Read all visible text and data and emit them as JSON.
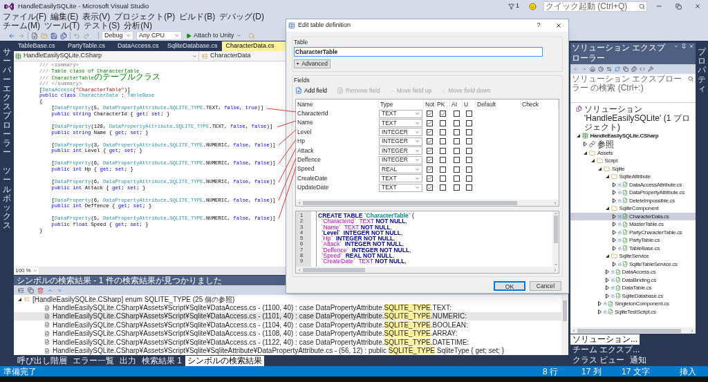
{
  "window": {
    "title": "HandleEasilySQLite - Microsoft Visual Studio"
  },
  "title_bar": {
    "notifications": "1",
    "quick_launch": {
      "placeholder": "クイック起動 (Ctrl+Q)"
    }
  },
  "menu": [
    "ファイル(F)",
    "編集(E)",
    "表示(V)",
    "プロジェクト(P)",
    "ビルド(B)",
    "デバッグ(D)",
    "チーム(M)",
    "ツール(T)",
    "テスト(S)",
    "分析(N)"
  ],
  "toolbar": {
    "configuration": "Debug",
    "platform": "Any CPU",
    "run_button": "Attach to Unity"
  },
  "left_strip": [
    "サーバーエクスプローラー",
    "ツールボックス"
  ],
  "editor": {
    "tabs": [
      {
        "label": "TableBase.cs",
        "selected": false
      },
      {
        "label": "PartyTable.cs",
        "selected": false
      },
      {
        "label": "DataAccess.cs",
        "selected": false
      },
      {
        "label": "SqliteDatabase.cs",
        "selected": false
      },
      {
        "label": "CharacterData.cs",
        "selected": true
      }
    ],
    "project": "HandleEasilySQLite.CSharp",
    "member": "CharacterData",
    "zoom": "100 %",
    "lines": [
      {
        "tokens": [
          {
            "kind": "doc",
            "text": "/// <summary>"
          }
        ]
      },
      {
        "tokens": [
          {
            "kind": "doc",
            "text": "/// "
          },
          {
            "kind": "cm",
            "text": "Table class of CharacterTable"
          }
        ]
      },
      {
        "tokens": [
          {
            "kind": "doc",
            "text": "/// "
          },
          {
            "kind": "cm",
            "text": "CharacterTable"
          },
          {
            "kind": "cmj",
            "text": "のテーブルクラス"
          }
        ]
      },
      {
        "tokens": [
          {
            "kind": "doc",
            "text": "/// </summary>"
          }
        ]
      },
      {
        "tokens": [
          {
            "kind": "p",
            "text": "["
          },
          {
            "kind": "ty",
            "text": "DataAccess"
          },
          {
            "kind": "p",
            "text": "("
          },
          {
            "kind": "str",
            "text": "\"CharacterTable\""
          },
          {
            "kind": "p",
            "text": ")]"
          }
        ]
      },
      {
        "tokens": [
          {
            "kind": "kw",
            "text": "public class "
          },
          {
            "kind": "ty",
            "text": "CharacterData"
          },
          {
            "kind": "p",
            "text": " : "
          },
          {
            "kind": "ty",
            "text": "TableBase"
          }
        ]
      },
      {
        "tokens": [
          {
            "kind": "p",
            "text": "{"
          }
        ]
      },
      {
        "tokens": [
          {
            "kind": "p",
            "text": "    ["
          },
          {
            "kind": "ty",
            "text": "DataProperty"
          },
          {
            "kind": "p",
            "text": "(5, "
          },
          {
            "kind": "ty",
            "text": "DataPropertyAttribute"
          },
          {
            "kind": "p",
            "text": "."
          },
          {
            "kind": "ty",
            "text": "SQLITE_TYPE"
          },
          {
            "kind": "p",
            "text": ".TEXT, "
          },
          {
            "kind": "kw",
            "text": "false"
          },
          {
            "kind": "p",
            "text": ", "
          },
          {
            "kind": "kw",
            "text": "true"
          },
          {
            "kind": "p",
            "text": ")]"
          }
        ]
      },
      {
        "tokens": [
          {
            "kind": "kw",
            "text": "    public string "
          },
          {
            "kind": "p",
            "text": "CharacterId { "
          },
          {
            "kind": "kw",
            "text": "get"
          },
          {
            "kind": "p",
            "text": "; "
          },
          {
            "kind": "kw",
            "text": "set"
          },
          {
            "kind": "p",
            "text": "; }"
          }
        ]
      },
      {
        "blank": true
      },
      {
        "tokens": [
          {
            "kind": "p",
            "text": "    ["
          },
          {
            "kind": "ty",
            "text": "DataProperty"
          },
          {
            "kind": "p",
            "text": "(128, "
          },
          {
            "kind": "ty",
            "text": "DataPropertyAttribute"
          },
          {
            "kind": "p",
            "text": "."
          },
          {
            "kind": "ty",
            "text": "SQLITE_TYPE"
          },
          {
            "kind": "p",
            "text": ".TEXT, "
          },
          {
            "kind": "kw",
            "text": "false"
          },
          {
            "kind": "p",
            "text": ", "
          },
          {
            "kind": "kw",
            "text": "false"
          },
          {
            "kind": "p",
            "text": ")]"
          }
        ]
      },
      {
        "tokens": [
          {
            "kind": "kw",
            "text": "    public string "
          },
          {
            "kind": "p",
            "text": "Name { "
          },
          {
            "kind": "kw",
            "text": "get"
          },
          {
            "kind": "p",
            "text": "; "
          },
          {
            "kind": "kw",
            "text": "set"
          },
          {
            "kind": "p",
            "text": "; }"
          }
        ]
      },
      {
        "blank": true
      },
      {
        "tokens": [
          {
            "kind": "p",
            "text": "    ["
          },
          {
            "kind": "ty",
            "text": "DataProperty"
          },
          {
            "kind": "p",
            "text": "(3, "
          },
          {
            "kind": "ty",
            "text": "DataPropertyAttribute"
          },
          {
            "kind": "p",
            "text": "."
          },
          {
            "kind": "ty",
            "text": "SQLITE_TYPE"
          },
          {
            "kind": "p",
            "text": ".NUMERIC, "
          },
          {
            "kind": "kw",
            "text": "false"
          },
          {
            "kind": "p",
            "text": ", "
          },
          {
            "kind": "kw",
            "text": "false"
          },
          {
            "kind": "p",
            "text": ")]"
          }
        ]
      },
      {
        "tokens": [
          {
            "kind": "kw",
            "text": "    public int "
          },
          {
            "kind": "p",
            "text": "Level { "
          },
          {
            "kind": "kw",
            "text": "get"
          },
          {
            "kind": "p",
            "text": "; "
          },
          {
            "kind": "kw",
            "text": "set"
          },
          {
            "kind": "p",
            "text": "; }"
          }
        ]
      },
      {
        "blank": true
      },
      {
        "tokens": [
          {
            "kind": "p",
            "text": "    ["
          },
          {
            "kind": "ty",
            "text": "DataProperty"
          },
          {
            "kind": "p",
            "text": "(6, "
          },
          {
            "kind": "ty",
            "text": "DataPropertyAttribute"
          },
          {
            "kind": "p",
            "text": "."
          },
          {
            "kind": "ty",
            "text": "SQLITE_TYPE"
          },
          {
            "kind": "p",
            "text": ".NUMERIC, "
          },
          {
            "kind": "kw",
            "text": "false"
          },
          {
            "kind": "p",
            "text": ", "
          },
          {
            "kind": "kw",
            "text": "false"
          },
          {
            "kind": "p",
            "text": ")]"
          }
        ]
      },
      {
        "tokens": [
          {
            "kind": "kw",
            "text": "    public int "
          },
          {
            "kind": "p",
            "text": "Hp { "
          },
          {
            "kind": "kw",
            "text": "get"
          },
          {
            "kind": "p",
            "text": "; "
          },
          {
            "kind": "kw",
            "text": "set"
          },
          {
            "kind": "p",
            "text": "; }"
          }
        ]
      },
      {
        "blank": true
      },
      {
        "tokens": [
          {
            "kind": "p",
            "text": "    ["
          },
          {
            "kind": "ty",
            "text": "DataProperty"
          },
          {
            "kind": "p",
            "text": "(6, "
          },
          {
            "kind": "ty",
            "text": "DataPropertyAttribute"
          },
          {
            "kind": "p",
            "text": "."
          },
          {
            "kind": "ty",
            "text": "SQLITE_TYPE"
          },
          {
            "kind": "p",
            "text": ".NUMERIC, "
          },
          {
            "kind": "kw",
            "text": "false"
          },
          {
            "kind": "p",
            "text": ", "
          },
          {
            "kind": "kw",
            "text": "false"
          },
          {
            "kind": "p",
            "text": ")]"
          }
        ]
      },
      {
        "tokens": [
          {
            "kind": "kw",
            "text": "    public int "
          },
          {
            "kind": "p",
            "text": "Attack { "
          },
          {
            "kind": "kw",
            "text": "get"
          },
          {
            "kind": "p",
            "text": "; "
          },
          {
            "kind": "kw",
            "text": "set"
          },
          {
            "kind": "p",
            "text": "; }"
          }
        ]
      },
      {
        "blank": true
      },
      {
        "tokens": [
          {
            "kind": "p",
            "text": "    ["
          },
          {
            "kind": "ty",
            "text": "DataProperty"
          },
          {
            "kind": "p",
            "text": "(6, "
          },
          {
            "kind": "ty",
            "text": "DataPropertyAttribute"
          },
          {
            "kind": "p",
            "text": "."
          },
          {
            "kind": "ty",
            "text": "SQLITE_TYPE"
          },
          {
            "kind": "p",
            "text": ".NUMERIC, "
          },
          {
            "kind": "kw",
            "text": "false"
          },
          {
            "kind": "p",
            "text": ", "
          },
          {
            "kind": "kw",
            "text": "false"
          },
          {
            "kind": "p",
            "text": ")]"
          }
        ]
      },
      {
        "tokens": [
          {
            "kind": "kw",
            "text": "    public int "
          },
          {
            "kind": "p",
            "text": "Deffence { "
          },
          {
            "kind": "kw",
            "text": "get"
          },
          {
            "kind": "p",
            "text": "; "
          },
          {
            "kind": "kw",
            "text": "set"
          },
          {
            "kind": "p",
            "text": "; }"
          }
        ]
      },
      {
        "blank": true
      },
      {
        "tokens": [
          {
            "kind": "p",
            "text": "    ["
          },
          {
            "kind": "ty",
            "text": "DataProperty"
          },
          {
            "kind": "p",
            "text": "(5, "
          },
          {
            "kind": "ty",
            "text": "DataPropertyAttribute"
          },
          {
            "kind": "p",
            "text": "."
          },
          {
            "kind": "ty",
            "text": "SQLITE_TYPE"
          },
          {
            "kind": "p",
            "text": ".NUMERIC, "
          },
          {
            "kind": "kw",
            "text": "false"
          },
          {
            "kind": "p",
            "text": ", "
          },
          {
            "kind": "kw",
            "text": "false"
          },
          {
            "kind": "p",
            "text": ")]"
          }
        ]
      },
      {
        "tokens": [
          {
            "kind": "kw",
            "text": "    public float "
          },
          {
            "kind": "p",
            "text": "Speed { "
          },
          {
            "kind": "kw",
            "text": "get"
          },
          {
            "kind": "p",
            "text": "; "
          },
          {
            "kind": "kw",
            "text": "set"
          },
          {
            "kind": "p",
            "text": "; }"
          }
        ]
      },
      {
        "tokens": [
          {
            "kind": "p",
            "text": "}"
          }
        ]
      }
    ]
  },
  "dialog": {
    "title": "Edit table definition",
    "help": "?",
    "table_group": "Table",
    "table_name": "CharacterTable",
    "advanced_button": "Advanced",
    "fields_group": "Fields",
    "actions": [
      {
        "label": "Add field",
        "disabled": false
      },
      {
        "label": "Remove field",
        "disabled": true
      },
      {
        "label": "Move field up",
        "disabled": true
      },
      {
        "label": "Move field down",
        "disabled": true
      }
    ],
    "columns": [
      "Name",
      "Type",
      "Not",
      "PK",
      "AI",
      "U",
      "Default",
      "Check"
    ],
    "fields": [
      {
        "name": "CharacterId",
        "type": "TEXT",
        "not_null": true,
        "pk": true,
        "ai": false,
        "unique": false
      },
      {
        "name": "Name",
        "type": "TEXT",
        "not_null": true,
        "pk": false,
        "ai": false,
        "unique": false
      },
      {
        "name": "Level",
        "type": "INTEGER",
        "not_null": true,
        "pk": false,
        "ai": false,
        "unique": false
      },
      {
        "name": "Hp",
        "type": "INTEGER",
        "not_null": true,
        "pk": false,
        "ai": false,
        "unique": false
      },
      {
        "name": "Attack",
        "type": "INTEGER",
        "not_null": true,
        "pk": false,
        "ai": false,
        "unique": false
      },
      {
        "name": "Deffence",
        "type": "INTEGER",
        "not_null": true,
        "pk": false,
        "ai": false,
        "unique": false
      },
      {
        "name": "Speed",
        "type": "REAL",
        "not_null": true,
        "pk": false,
        "ai": false,
        "unique": false
      },
      {
        "name": "CreateDate",
        "type": "TEXT",
        "not_null": true,
        "pk": false,
        "ai": false,
        "unique": false
      },
      {
        "name": "UpdateDate",
        "type": "TEXT",
        "not_null": true,
        "pk": false,
        "ai": false,
        "unique": false
      }
    ],
    "sql_lines": [
      {
        "number": "1",
        "tokens": [
          {
            "kind": "kw",
            "text": "CREATE TABLE "
          },
          {
            "kind": "tbl",
            "text": "`CharacterTable`"
          },
          {
            "kind": "p",
            "text": " ("
          }
        ]
      },
      {
        "number": "2",
        "tokens": [
          {
            "kind": "col",
            "text": "  `CharacterId`  "
          },
          {
            "kind": "col",
            "text": "TEXT"
          },
          {
            "kind": "kw",
            "text": " NOT NULL"
          },
          {
            "kind": "p",
            "text": ","
          }
        ]
      },
      {
        "number": "3",
        "tokens": [
          {
            "kind": "col",
            "text": "  `Name`  "
          },
          {
            "kind": "col",
            "text": "TEXT"
          },
          {
            "kind": "kw",
            "text": " NOT NULL"
          },
          {
            "kind": "p",
            "text": ","
          }
        ]
      },
      {
        "number": "4",
        "tokens": [
          {
            "kind": "kw",
            "text": "  `Level`  INTEGER NOT NULL"
          },
          {
            "kind": "p",
            "text": ","
          }
        ]
      },
      {
        "number": "5",
        "tokens": [
          {
            "kind": "col",
            "text": "  `Hp`"
          },
          {
            "kind": "kw",
            "text": "  INTEGER NOT NULL"
          },
          {
            "kind": "p",
            "text": ","
          }
        ]
      },
      {
        "number": "6",
        "tokens": [
          {
            "kind": "col",
            "text": "  `Attack`"
          },
          {
            "kind": "kw",
            "text": "  INTEGER NOT NULL"
          },
          {
            "kind": "p",
            "text": ","
          }
        ]
      },
      {
        "number": "7",
        "tokens": [
          {
            "kind": "col",
            "text": "  `Deffence`"
          },
          {
            "kind": "kw",
            "text": "  INTEGER NOT NULL"
          },
          {
            "kind": "p",
            "text": ","
          }
        ]
      },
      {
        "number": "8",
        "tokens": [
          {
            "kind": "col",
            "text": "  `Speed`"
          },
          {
            "kind": "kw",
            "text": "  REAL NOT NULL"
          },
          {
            "kind": "p",
            "text": ","
          }
        ]
      },
      {
        "number": "9",
        "tokens": [
          {
            "kind": "col",
            "text": "  `CreateDate`  "
          },
          {
            "kind": "col",
            "text": "TEXT"
          },
          {
            "kind": "kw",
            "text": " NOT NULL"
          },
          {
            "kind": "p",
            "text": ","
          }
        ]
      }
    ],
    "buttons": [
      {
        "label": "OK",
        "default": true
      },
      {
        "label": "Cancel",
        "default": false
      }
    ]
  },
  "solution_explorer": {
    "title": "ソリューション エクスプローラー",
    "search": {
      "placeholder": "ソリューション エクスプローラー の検索 (Ctrl+:)"
    },
    "tree": [
      {
        "kind": "solution",
        "label": "ソリューション 'HandleEasilySQLite' (1 プロジェクト)",
        "selected": false,
        "children": [
          {
            "kind": "project",
            "label": "HandleEasilySQLite.CSharp",
            "expanded": true,
            "selected": false,
            "children": [
              {
                "kind": "references",
                "label": "参照",
                "expanded": false,
                "selected": false
              },
              {
                "kind": "folder",
                "label": "Assets",
                "expanded": true,
                "selected": false,
                "children": [
                  {
                    "kind": "folder",
                    "label": "Script",
                    "expanded": true,
                    "selected": false,
                    "children": [
                      {
                        "kind": "folder",
                        "label": "Sqlite",
                        "expanded": true,
                        "selected": false,
                        "children": [
                          {
                            "kind": "folder",
                            "label": "SqliteAttribute",
                            "expanded": true,
                            "selected": false,
                            "children": [
                              {
                                "kind": "file",
                                "label": "DataAccessAttribute.cs",
                                "expanded": false,
                                "selected": false
                              },
                              {
                                "kind": "file",
                                "label": "DataPropertyAttribute.cs",
                                "expanded": false,
                                "selected": false
                              },
                              {
                                "kind": "file",
                                "label": "DeleteImpossible.cs",
                                "expanded": false,
                                "selected": false
                              }
                            ]
                          },
                          {
                            "kind": "folder",
                            "label": "SqliteComponent",
                            "expanded": true,
                            "selected": false,
                            "children": [
                              {
                                "kind": "file",
                                "label": "CharacterData.cs",
                                "expanded": false,
                                "selected": true
                              },
                              {
                                "kind": "file",
                                "label": "MasterTable.cs",
                                "expanded": false,
                                "selected": false
                              },
                              {
                                "kind": "file",
                                "label": "PartyCharacterTable.cs",
                                "expanded": false,
                                "selected": false
                              },
                              {
                                "kind": "file",
                                "label": "PartyTable.cs",
                                "expanded": false,
                                "selected": false
                              },
                              {
                                "kind": "file",
                                "label": "TableBase.cs",
                                "expanded": false,
                                "selected": false
                              }
                            ]
                          },
                          {
                            "kind": "folder",
                            "label": "SqliteService",
                            "expanded": true,
                            "selected": false,
                            "children": [
                              {
                                "kind": "file",
                                "label": "SqliteTableService.cs",
                                "expanded": false,
                                "selected": false
                              }
                            ]
                          },
                          {
                            "kind": "file",
                            "label": "DataAccess.cs",
                            "expanded": false,
                            "selected": false
                          },
                          {
                            "kind": "file",
                            "label": "DataBinding.cs",
                            "expanded": false,
                            "selected": false
                          },
                          {
                            "kind": "file",
                            "label": "DataTable.cs",
                            "expanded": false,
                            "selected": false
                          },
                          {
                            "kind": "file",
                            "label": "SqliteDatabase.cs",
                            "expanded": false,
                            "selected": false
                          }
                        ]
                      },
                      {
                        "kind": "file",
                        "label": "SingletonComponent.cs",
                        "expanded": false,
                        "selected": false
                      },
                      {
                        "kind": "file",
                        "label": "SqliteTestScript.cs",
                        "expanded": false,
                        "selected": false
                      }
                    ]
                  }
                ]
              }
            ]
          }
        ]
      }
    ],
    "tabs": [
      {
        "label": "ソリューション...",
        "selected": true
      },
      {
        "label": "チーム エクスプ...",
        "selected": false
      },
      {
        "label": "クラス ビュー",
        "selected": false
      },
      {
        "label": "通知",
        "selected": false
      }
    ]
  },
  "right_strip": [
    "プロパティ"
  ],
  "results_panel": {
    "title": "シンボルの検索結果 - 1 件の検索結果が見つかりました",
    "root": {
      "label": "[HandleEasilySQLite.CSharp] enum SQLITE_TYPE (25 個の参照)",
      "expanded": true
    },
    "rows": [
      {
        "before": "HandleEasilySQLite.CSharp¥Assets¥Script¥Sqlite¥DataAccess.cs - (1100, 40) : case DataPropertyAttribute.",
        "match": "SQLITE_TYPE",
        "after": ".TEXT:",
        "selected": false
      },
      {
        "before": "HandleEasilySQLite.CSharp¥Assets¥Script¥Sqlite¥DataAccess.cs - (1101, 40) : case DataPropertyAttribute.",
        "match": "SQLITE_TYPE",
        "after": ".NUMERIC:",
        "selected": true
      },
      {
        "before": "HandleEasilySQLite.CSharp¥Assets¥Script¥Sqlite¥DataAccess.cs - (1104, 40) : case DataPropertyAttribute.",
        "match": "SQLITE_TYPE",
        "after": ".BOOLEAN:",
        "selected": false
      },
      {
        "before": "HandleEasilySQLite.CSharp¥Assets¥Script¥Sqlite¥DataAccess.cs - (1108, 40) : case DataPropertyAttribute.",
        "match": "SQLITE_TYPE",
        "after": ".ARRAY:",
        "selected": false
      },
      {
        "before": "HandleEasilySQLite.CSharp¥Assets¥Script¥Sqlite¥DataAccess.cs - (1122, 40) : case DataPropertyAttribute.",
        "match": "SQLITE_TYPE",
        "after": ".DATETIME:",
        "selected": false
      },
      {
        "before": "HandleEasilySQLite.CSharp¥Assets¥Script¥Sqlite¥SqliteAttribute¥DataPropertyAttribute.cs - (56, 12) : public ",
        "match": "SQLITE_TYPE",
        "after": " SqliteType { get; set; }",
        "selected": false
      }
    ],
    "tabs": [
      {
        "label": "呼び出し階層",
        "selected": false
      },
      {
        "label": "エラー一覧",
        "selected": false
      },
      {
        "label": "出力",
        "selected": false
      },
      {
        "label": "検索結果 1",
        "selected": false
      },
      {
        "label": "シンボルの検索結果",
        "selected": true
      }
    ]
  },
  "status_bar": {
    "message": "準備完了",
    "line": "8 行",
    "column": "17 列",
    "char": "17 文字",
    "mode": "挿入"
  }
}
